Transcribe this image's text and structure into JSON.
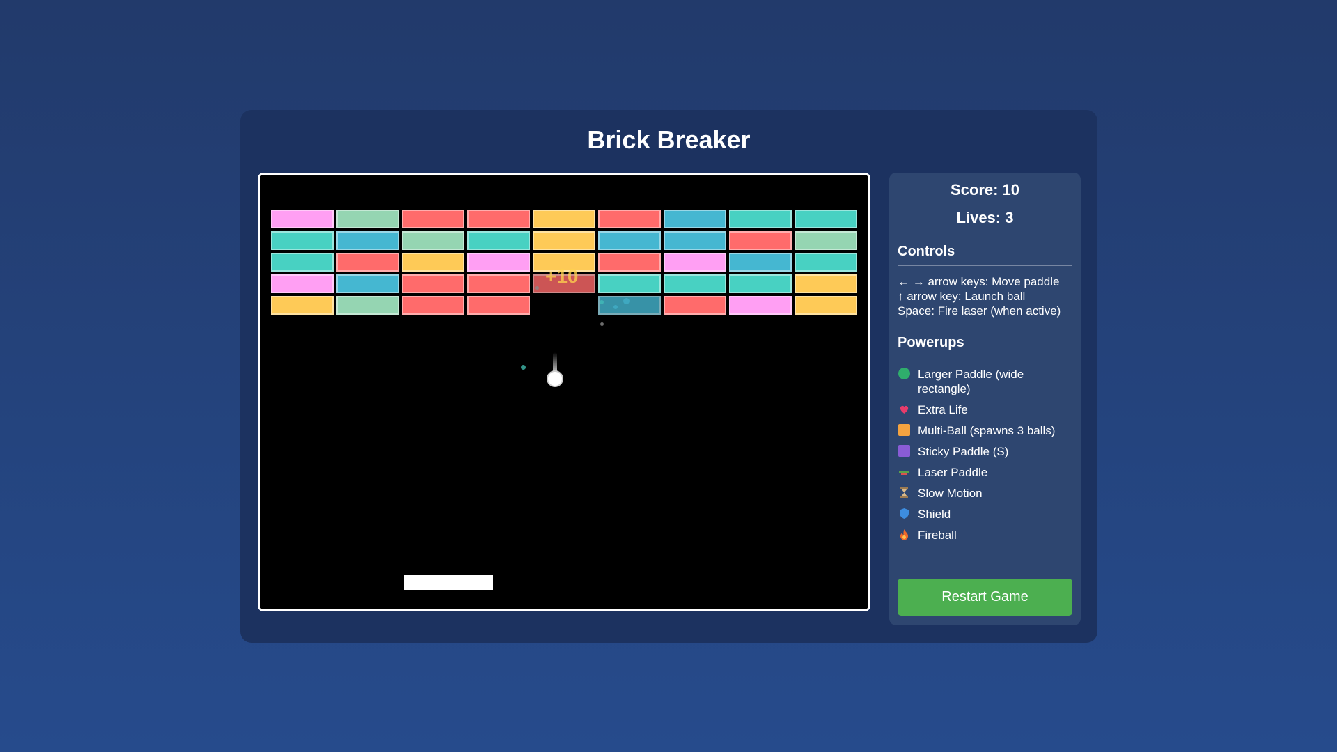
{
  "title": "Brick Breaker",
  "score_label": "Score: 10",
  "lives_label": "Lives: 3",
  "controls": {
    "heading": "Controls",
    "lines": [
      "← → arrow keys: Move paddle",
      "↑ arrow key: Launch ball",
      "Space: Fire laser (when active)"
    ]
  },
  "powerups": {
    "heading": "Powerups",
    "items": [
      {
        "icon": "green-circle-icon",
        "color": "#2fae6c",
        "label": "Larger Paddle (wide rectangle)"
      },
      {
        "icon": "heart-icon",
        "color": "#e83c6b",
        "label": "Extra Life"
      },
      {
        "icon": "orange-square-icon",
        "color": "#f4a340",
        "label": "Multi-Ball (spawns 3 balls)"
      },
      {
        "icon": "purple-square-icon",
        "color": "#8a5cd6",
        "label": "Sticky Paddle (S)"
      },
      {
        "icon": "laser-icon",
        "color": "#5aa14a",
        "label": "Laser Paddle"
      },
      {
        "icon": "hourglass-icon",
        "color": "#d9b98a",
        "label": "Slow Motion"
      },
      {
        "icon": "shield-icon",
        "color": "#3d8de0",
        "label": "Shield"
      },
      {
        "icon": "fire-icon",
        "color": "#ef6a2a",
        "label": "Fireball"
      }
    ]
  },
  "restart_label": "Restart Game",
  "score_popup": "+10",
  "colors": {
    "pink": "#ff9ff3",
    "sage": "#95d5b2",
    "red": "#ff6b6b",
    "yellow": "#feca57",
    "teal": "#48d1c2",
    "blue": "#45b7d1",
    "restart_button": "#4caf50"
  },
  "bricks": [
    [
      "pink",
      "sage",
      "red",
      "red",
      "yellow",
      "red",
      "blue",
      "teal",
      "teal"
    ],
    [
      "teal",
      "blue",
      "sage",
      "teal",
      "yellow",
      "blue",
      "blue",
      "red",
      "sage"
    ],
    [
      "teal",
      "red",
      "yellow",
      "pink",
      "yellow",
      "red",
      "pink",
      "blue",
      "teal"
    ],
    [
      "pink",
      "blue",
      "red",
      "red",
      "red-hit",
      "teal",
      "teal",
      "teal",
      "yellow"
    ],
    [
      "yellow",
      "sage",
      "red",
      "red",
      null,
      "blue-hit",
      "red",
      "pink",
      "yellow"
    ]
  ]
}
